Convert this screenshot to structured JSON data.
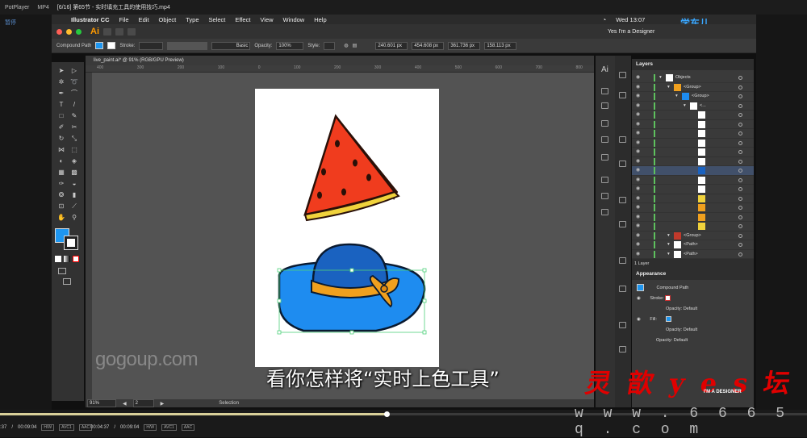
{
  "player": {
    "app": "PotPlayer",
    "format": "MP4",
    "file_title": "[6/16] 第65节 - 实时填充工具的使用技巧.mp4",
    "paused": "暂停",
    "time_left": ":37",
    "total_left": "00:09:04",
    "time_mid": "00:04:37",
    "total_mid": "00:09:04",
    "tags": [
      "H/W",
      "AVC1",
      "AAC"
    ]
  },
  "menubar": {
    "app_name": "Illustrator CC",
    "items": [
      "File",
      "Edit",
      "Object",
      "Type",
      "Select",
      "Effect",
      "View",
      "Window",
      "Help"
    ],
    "clock": "Wed 13:07"
  },
  "appbar": {
    "logo": "Ai",
    "workspace": "Yes I'm a Designer"
  },
  "control": {
    "selection_type": "Compound Path",
    "stroke_label": "Stroke:",
    "brush": "Basic",
    "opacity_label": "Opacity:",
    "opacity": "100%",
    "style_label": "Style:",
    "x": "240.601 px",
    "y": "454.608 px",
    "w": "361.736 px",
    "h": "158.113 px"
  },
  "document": {
    "tab": "live_paint.ai* @ 91% (RGB/GPU Preview)",
    "ruler_ticks": [
      "400",
      "300",
      "200",
      "100",
      "0",
      "100",
      "200",
      "300",
      "400",
      "500",
      "600",
      "700",
      "800"
    ],
    "zoom": "91%",
    "page": "2",
    "status": "Selection"
  },
  "layers": {
    "title": "Layers",
    "rows": [
      {
        "label": "Objects",
        "indent": 0
      },
      {
        "label": "<Group>",
        "indent": 1
      },
      {
        "label": "<Group>",
        "indent": 2
      },
      {
        "label": "<...",
        "indent": 3
      },
      {
        "label": "",
        "indent": 4
      },
      {
        "label": "",
        "indent": 4
      },
      {
        "label": "",
        "indent": 4
      },
      {
        "label": "",
        "indent": 4
      },
      {
        "label": "",
        "indent": 4
      },
      {
        "label": "",
        "indent": 4
      },
      {
        "label": "",
        "indent": 4
      },
      {
        "label": "",
        "indent": 4
      },
      {
        "label": "",
        "indent": 4
      },
      {
        "label": "",
        "indent": 4
      },
      {
        "label": "",
        "indent": 4
      },
      {
        "label": "",
        "indent": 4
      },
      {
        "label": "",
        "indent": 4
      },
      {
        "label": "<Group>",
        "indent": 1
      },
      {
        "label": "<Path>",
        "indent": 1
      },
      {
        "label": "<Path>",
        "indent": 1
      }
    ],
    "footer": "1 Layer"
  },
  "appearance": {
    "title": "Appearance",
    "object": "Compound Path",
    "stroke_label": "Stroke:",
    "opacity1": "Opacity: Default",
    "fill_label": "Fill:",
    "opacity2": "Opacity: Default",
    "opacity3": "Opacity: Default"
  },
  "overlay": {
    "subtitle": "看你怎样将“实时上色工具”",
    "gogoup": "gogoup.com",
    "watermark_cn": "灵歆yes坛",
    "watermark_sub": "I'M A DESIGNER",
    "watermark_url": "w w w . 6 6 6 5 q . c o m",
    "xuedong": "学东儿"
  },
  "colors": {
    "fill_swatch": "#1e96f0",
    "watermelon_red": "#f03c1e",
    "rind_yellow": "#f0d23c",
    "hat_blue": "#1e8cf0",
    "bow_orange": "#f0a01e"
  }
}
